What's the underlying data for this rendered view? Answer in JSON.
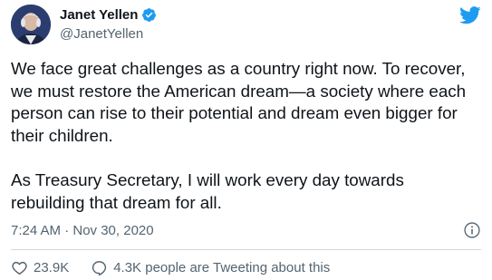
{
  "author": {
    "name": "Janet Yellen",
    "handle": "@JanetYellen",
    "verified": true
  },
  "tweet": {
    "text": "We face great challenges as a country right now. To recover,\nwe must restore the American dream—a society where each\nperson can rise to their potential and dream even bigger for\ntheir children.\n\nAs Treasury Secretary, I will work every day towards\nrebuilding that dream for all.",
    "timestamp": "7:24 AM · Nov 30, 2020"
  },
  "actions": {
    "likes": "23.9K",
    "conversation": "4.3K people are Tweeting about this"
  },
  "icons": {
    "brand": "twitter-bird-icon",
    "verified": "verified-badge-icon",
    "info": "info-icon",
    "like": "heart-icon",
    "reply": "speech-bubble-icon"
  },
  "colors": {
    "brand": "#1d9bf0",
    "text": "#0f1419",
    "secondary": "#536471",
    "divider": "#cfd9de"
  }
}
